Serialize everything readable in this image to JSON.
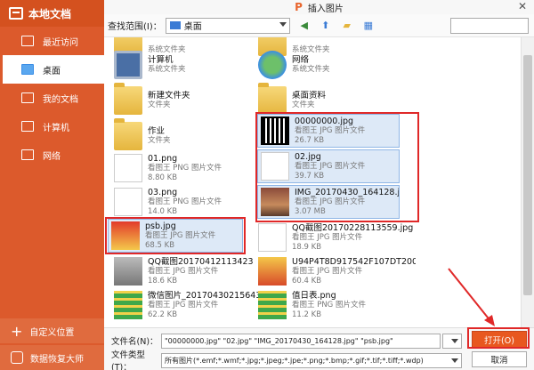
{
  "title": "插入图片",
  "sidebar": {
    "header": "本地文档",
    "items": [
      {
        "label": "最近访问",
        "active": false
      },
      {
        "label": "桌面",
        "active": true
      },
      {
        "label": "我的文档",
        "active": false
      },
      {
        "label": "计算机",
        "active": false
      },
      {
        "label": "网络",
        "active": false
      }
    ],
    "custom_location": "自定义位置",
    "data_recovery": "数据恢复大师"
  },
  "toolbar": {
    "look_in_label": "查找范围(I)：",
    "look_in_value": "桌面"
  },
  "files": [
    {
      "name": "计算机",
      "type": "系统文件夹",
      "size": ""
    },
    {
      "name": "网络",
      "type": "系统文件夹",
      "size": ""
    },
    {
      "name": "新建文件夹",
      "type": "文件夹",
      "size": ""
    },
    {
      "name": "桌面资料",
      "type": "文件夹",
      "size": ""
    },
    {
      "name": "作业",
      "type": "文件夹",
      "size": ""
    },
    {
      "name": "00000000.jpg",
      "type": "看图王 JPG 图片文件",
      "size": "26.7 KB"
    },
    {
      "name": "01.png",
      "type": "看图王 PNG 图片文件",
      "size": "8.80 KB"
    },
    {
      "name": "02.jpg",
      "type": "看图王 JPG 图片文件",
      "size": "39.7 KB"
    },
    {
      "name": "03.png",
      "type": "看图王 PNG 图片文件",
      "size": "14.0 KB"
    },
    {
      "name": "IMG_20170430_164128.jpg",
      "type": "看图王 JPG 图片文件",
      "size": "3.07 MB"
    },
    {
      "name": "psb.jpg",
      "type": "看图王 JPG 图片文件",
      "size": "68.5 KB"
    },
    {
      "name": "QQ截图20170228113559.jpg",
      "type": "看图王 JPG 图片文件",
      "size": "18.9 KB"
    },
    {
      "name": "QQ截图20170412113423.jpg",
      "type": "看图王 JPG 图片文件",
      "size": "18.6 KB"
    },
    {
      "name": "U94P4T8D917542F107DT200...",
      "type": "看图王 JPG 图片文件",
      "size": "60.4 KB"
    },
    {
      "name": "微信图片_20170430215643.jpg",
      "type": "看图王 JPG 图片文件",
      "size": "62.2 KB"
    },
    {
      "name": "值日表.png",
      "type": "看图王 PNG 图片文件",
      "size": "11.2 KB"
    }
  ],
  "bottom": {
    "filename_label": "文件名(N)：",
    "filename_value": "\"00000000.jpg\" \"02.jpg\" \"IMG_20170430_164128.jpg\" \"psb.jpg\"",
    "filetype_label": "文件类型(T)：",
    "filetype_value": "所有图片(*.emf;*.wmf;*.jpg;*.jpeg;*.jpe;*.png;*.bmp;*.gif;*.tif;*.tiff;*.wdp)",
    "insert_label": "打开(O)",
    "cancel_label": "取消"
  }
}
